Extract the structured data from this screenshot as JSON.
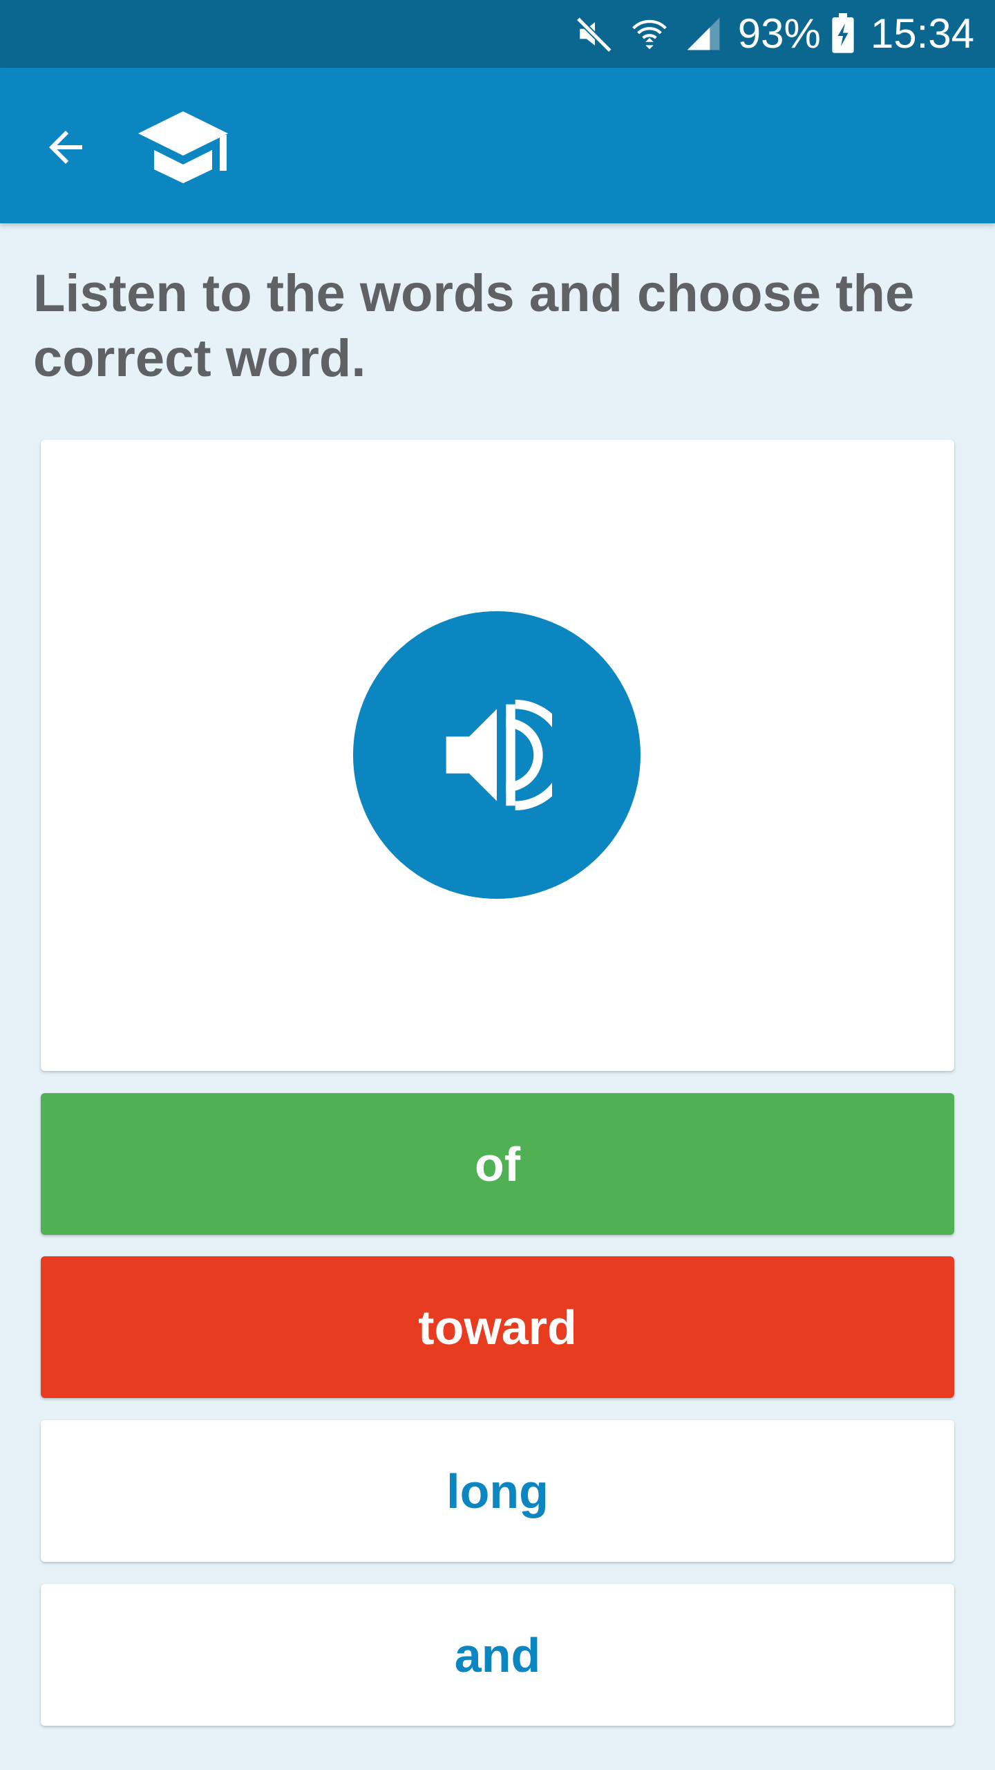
{
  "status_bar": {
    "battery": "93%",
    "time": "15:34",
    "icons": [
      "mute-icon",
      "wifi-icon",
      "signal-icon",
      "battery-charging-icon"
    ]
  },
  "app_bar": {
    "back_icon": "arrow-left-icon",
    "logo_icon": "graduation-cap-icon",
    "color": "#0b86c1"
  },
  "exercise": {
    "instruction": "Listen to the words and choose the correct word.",
    "audio_icon": "speaker-icon",
    "options": [
      {
        "label": "of",
        "state": "correct"
      },
      {
        "label": "toward",
        "state": "wrong"
      },
      {
        "label": "long",
        "state": "neutral"
      },
      {
        "label": "and",
        "state": "neutral"
      }
    ]
  },
  "colors": {
    "status_bar": "#0b6690",
    "primary": "#0b86c1",
    "background": "#e6f2f8",
    "correct": "#4fb153",
    "wrong": "#e83c20",
    "instruction_text": "#5f6164"
  }
}
